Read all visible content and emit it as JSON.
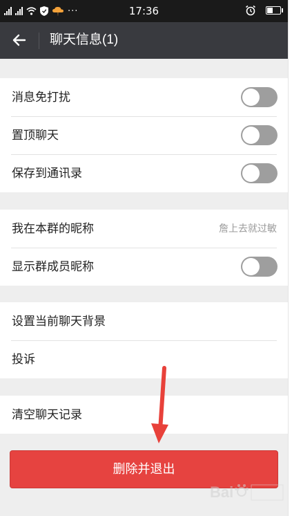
{
  "status_bar": {
    "time": "17:36",
    "more": "···"
  },
  "header": {
    "title": "聊天信息(1)"
  },
  "settings_group_1": [
    {
      "label": "消息免打扰",
      "toggle": "off"
    },
    {
      "label": "置顶聊天",
      "toggle": "off"
    },
    {
      "label": "保存到通讯录",
      "toggle": "off"
    }
  ],
  "settings_group_2": [
    {
      "label": "我在本群的昵称",
      "value": "詹上去就过敏"
    },
    {
      "label": "显示群成员昵称",
      "toggle": "off"
    }
  ],
  "settings_group_3": [
    {
      "label": "设置当前聊天背景"
    },
    {
      "label": "投诉"
    }
  ],
  "settings_group_4": [
    {
      "label": "清空聊天记录"
    }
  ],
  "delete_button": {
    "label": "删除并退出"
  },
  "colors": {
    "header_bg": "#393a3f",
    "delete_button": "#e64340",
    "annotation_arrow": "#e8413a",
    "toggle_off": "#9e9e9e"
  },
  "icons": [
    "signal-icon",
    "wifi-icon",
    "shield-icon",
    "weather-icon",
    "alarm-icon",
    "battery-icon",
    "back-arrow-icon"
  ]
}
